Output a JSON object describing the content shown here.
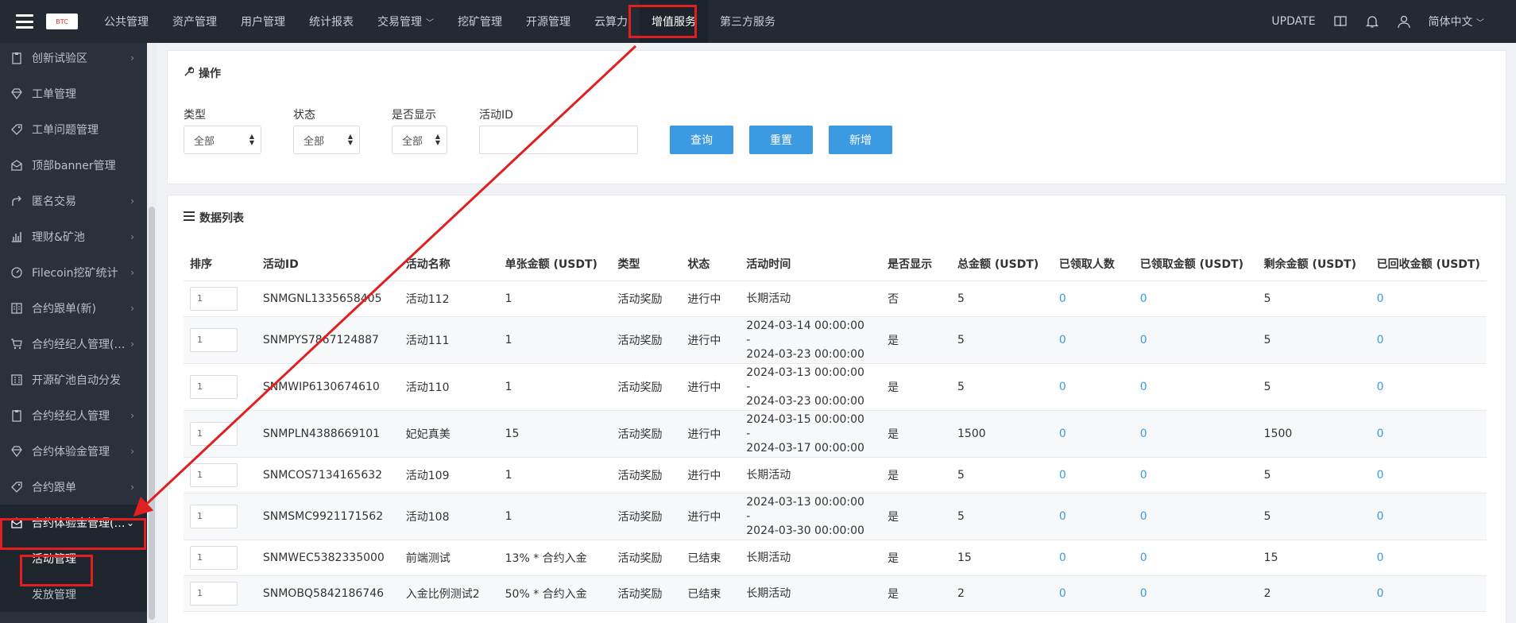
{
  "topbar": {
    "logo_text": "BTC",
    "nav": [
      {
        "label": "公共管理"
      },
      {
        "label": "资产管理"
      },
      {
        "label": "用户管理"
      },
      {
        "label": "统计报表"
      },
      {
        "label": "交易管理"
      },
      {
        "label": "挖矿管理"
      },
      {
        "label": "开源管理"
      },
      {
        "label": "云算力"
      },
      {
        "label": "增值服务"
      },
      {
        "label": "第三方服务"
      }
    ],
    "update_label": "UPDATE",
    "language": "简体中文"
  },
  "sidebar": {
    "items": [
      {
        "label": "创新试验区",
        "icon": "clipboard-icon",
        "has_children": true
      },
      {
        "label": "工单管理",
        "icon": "diamond-icon",
        "has_children": false
      },
      {
        "label": "工单问题管理",
        "icon": "tag-icon",
        "has_children": false
      },
      {
        "label": "顶部banner管理",
        "icon": "mail-icon",
        "has_children": false
      },
      {
        "label": "匿名交易",
        "icon": "share-icon",
        "has_children": true
      },
      {
        "label": "理财&矿池",
        "icon": "bar-chart-icon",
        "has_children": true
      },
      {
        "label": "Filecoin挖矿统计",
        "icon": "dashboard-icon",
        "has_children": true
      },
      {
        "label": "合约跟单(新)",
        "icon": "book-icon",
        "has_children": true
      },
      {
        "label": "合约经纪人管理(…",
        "icon": "cart-icon",
        "has_children": true
      },
      {
        "label": "开源矿池自动分发",
        "icon": "calculator-icon",
        "has_children": false
      },
      {
        "label": "合约经纪人管理",
        "icon": "clipboard-icon",
        "has_children": true
      },
      {
        "label": "合约体验金管理",
        "icon": "diamond-icon",
        "has_children": true
      },
      {
        "label": "合约跟单",
        "icon": "tag-icon",
        "has_children": true
      },
      {
        "label": "合约体验金管理(…",
        "icon": "mail-open-icon",
        "has_children": true,
        "open": true
      }
    ],
    "sub_items": [
      {
        "label": "活动管理",
        "active": true
      },
      {
        "label": "发放管理",
        "active": false
      }
    ]
  },
  "operations": {
    "title": "操作",
    "filters": {
      "type_label": "类型",
      "type_value": "全部",
      "status_label": "状态",
      "status_value": "全部",
      "display_label": "是否显示",
      "display_value": "全部",
      "activity_id_label": "活动ID",
      "activity_id_value": ""
    },
    "buttons": {
      "query": "查询",
      "reset": "重置",
      "add": "新增"
    }
  },
  "data_list": {
    "title": "数据列表",
    "columns": [
      "排序",
      "活动ID",
      "活动名称",
      "单张金额 (USDT)",
      "类型",
      "状态",
      "活动时间",
      "是否显示",
      "总金额 (USDT)",
      "已领取人数",
      "已领取金额 (USDT)",
      "剩余金额 (USDT)",
      "已回收金额 (USDT)"
    ],
    "rows": [
      {
        "sort": "1",
        "id": "SNMGNL1335658405",
        "name": "活动112",
        "unit": "1",
        "type": "活动奖励",
        "status": "进行中",
        "time_start": "长期活动",
        "time_sep": "",
        "time_end": "",
        "display": "否",
        "total": "5",
        "claimed_count": "0",
        "claimed_amount": "0",
        "remaining": "5",
        "recovered": "0"
      },
      {
        "sort": "1",
        "id": "SNMPYS7867124887",
        "name": "活动111",
        "unit": "1",
        "type": "活动奖励",
        "status": "进行中",
        "time_start": "2024-03-14 00:00:00",
        "time_sep": "-",
        "time_end": "2024-03-23 00:00:00",
        "display": "是",
        "total": "5",
        "claimed_count": "0",
        "claimed_amount": "0",
        "remaining": "5",
        "recovered": "0"
      },
      {
        "sort": "1",
        "id": "SNMWIP6130674610",
        "name": "活动110",
        "unit": "1",
        "type": "活动奖励",
        "status": "进行中",
        "time_start": "2024-03-13 00:00:00",
        "time_sep": "-",
        "time_end": "2024-03-23 00:00:00",
        "display": "是",
        "total": "5",
        "claimed_count": "0",
        "claimed_amount": "0",
        "remaining": "5",
        "recovered": "0"
      },
      {
        "sort": "1",
        "id": "SNMPLN4388669101",
        "name": "妃妃真美",
        "unit": "15",
        "type": "活动奖励",
        "status": "进行中",
        "time_start": "2024-03-15 00:00:00",
        "time_sep": "-",
        "time_end": "2024-03-17 00:00:00",
        "display": "是",
        "total": "1500",
        "claimed_count": "0",
        "claimed_amount": "0",
        "remaining": "1500",
        "recovered": "0"
      },
      {
        "sort": "1",
        "id": "SNMCOS7134165632",
        "name": "活动109",
        "unit": "1",
        "type": "活动奖励",
        "status": "进行中",
        "time_start": "长期活动",
        "time_sep": "",
        "time_end": "",
        "display": "是",
        "total": "5",
        "claimed_count": "0",
        "claimed_amount": "0",
        "remaining": "5",
        "recovered": "0"
      },
      {
        "sort": "1",
        "id": "SNMSMC9921171562",
        "name": "活动108",
        "unit": "1",
        "type": "活动奖励",
        "status": "进行中",
        "time_start": "2024-03-13 00:00:00",
        "time_sep": "-",
        "time_end": "2024-03-30 00:00:00",
        "display": "是",
        "total": "5",
        "claimed_count": "0",
        "claimed_amount": "0",
        "remaining": "5",
        "recovered": "0"
      },
      {
        "sort": "1",
        "id": "SNMWEC5382335000",
        "name": "前端测试",
        "unit": "13% * 合约入金",
        "type": "活动奖励",
        "status": "已结束",
        "time_start": "长期活动",
        "time_sep": "",
        "time_end": "",
        "display": "是",
        "total": "15",
        "claimed_count": "0",
        "claimed_amount": "0",
        "remaining": "15",
        "recovered": "0"
      },
      {
        "sort": "1",
        "id": "SNMOBQ5842186746",
        "name": "入金比例测试2",
        "unit": "50% * 合约入金",
        "type": "活动奖励",
        "status": "已结束",
        "time_start": "长期活动",
        "time_sep": "",
        "time_end": "",
        "display": "是",
        "total": "2",
        "claimed_count": "0",
        "claimed_amount": "0",
        "remaining": "2",
        "recovered": "0"
      }
    ]
  },
  "colors": {
    "topbar_bg": "#232a34",
    "sidebar_bg": "#2a313c",
    "accent": "#3b9ae1",
    "annotation": "#e02020"
  }
}
